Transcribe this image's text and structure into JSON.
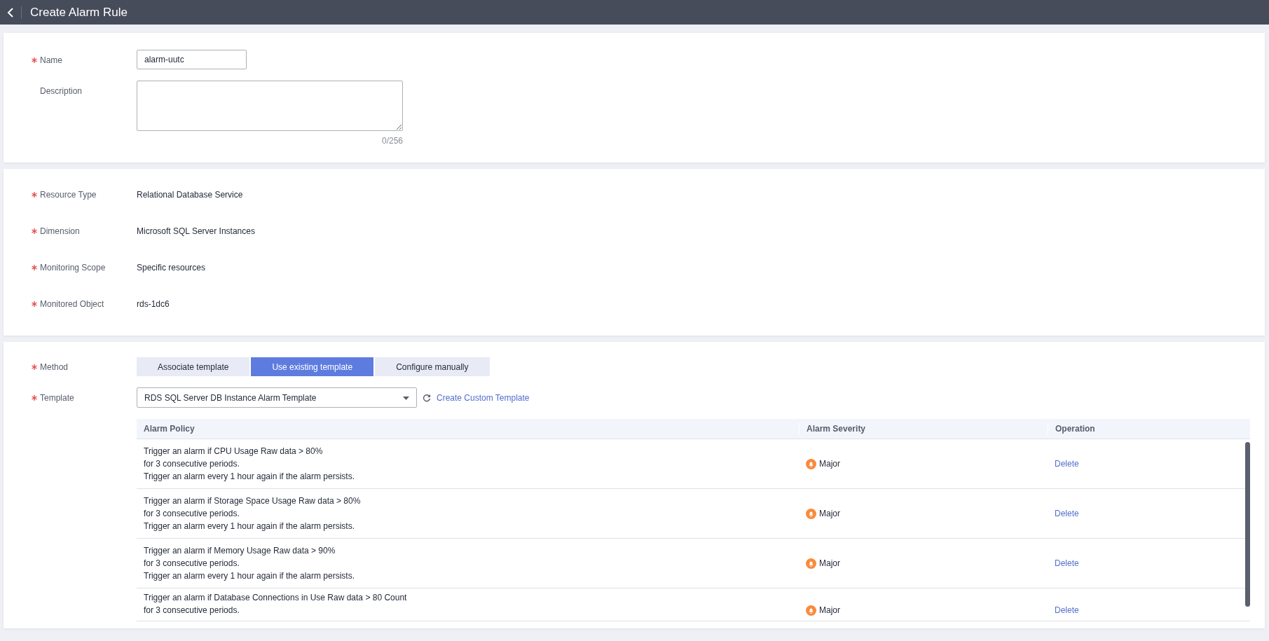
{
  "header": {
    "title": "Create Alarm Rule"
  },
  "basic": {
    "name": {
      "label": "Name",
      "required": true,
      "value": "alarm-uutc"
    },
    "description": {
      "label": "Description",
      "required": false,
      "counter": "0/256"
    }
  },
  "resource": [
    {
      "label": "Resource Type",
      "required": true,
      "value": "Relational Database Service"
    },
    {
      "label": "Dimension",
      "required": true,
      "value": "Microsoft SQL Server Instances"
    },
    {
      "label": "Monitoring Scope",
      "required": true,
      "value": "Specific resources"
    },
    {
      "label": "Monitored Object",
      "required": true,
      "value": "rds-1dc6"
    }
  ],
  "method": {
    "label": "Method",
    "required": true,
    "options": [
      {
        "label": "Associate template",
        "selected": false
      },
      {
        "label": "Use existing template",
        "selected": true
      },
      {
        "label": "Configure manually",
        "selected": false
      }
    ]
  },
  "template": {
    "label": "Template",
    "required": true,
    "value": "RDS SQL Server DB Instance Alarm Template",
    "link": "Create Custom Template"
  },
  "table": {
    "columns": [
      "Alarm Policy",
      "Alarm Severity",
      "Operation"
    ],
    "rows": [
      {
        "policy": [
          "Trigger an alarm if CPU Usage Raw data > 80%",
          "for 3 consecutive periods.",
          "Trigger an alarm every 1 hour again if the alarm persists."
        ],
        "severity": "Major",
        "operation": "Delete"
      },
      {
        "policy": [
          "Trigger an alarm if Storage Space Usage Raw data > 80%",
          "for 3 consecutive periods.",
          "Trigger an alarm every 1 hour again if the alarm persists."
        ],
        "severity": "Major",
        "operation": "Delete"
      },
      {
        "policy": [
          "Trigger an alarm if Memory Usage Raw data > 90%",
          "for 3 consecutive periods.",
          "Trigger an alarm every 1 hour again if the alarm persists."
        ],
        "severity": "Major",
        "operation": "Delete"
      },
      {
        "policy": [
          "Trigger an alarm if Database Connections in Use Raw data > 80 Count",
          "for 3 consecutive periods."
        ],
        "severity": "Major",
        "operation": "Delete"
      }
    ]
  }
}
